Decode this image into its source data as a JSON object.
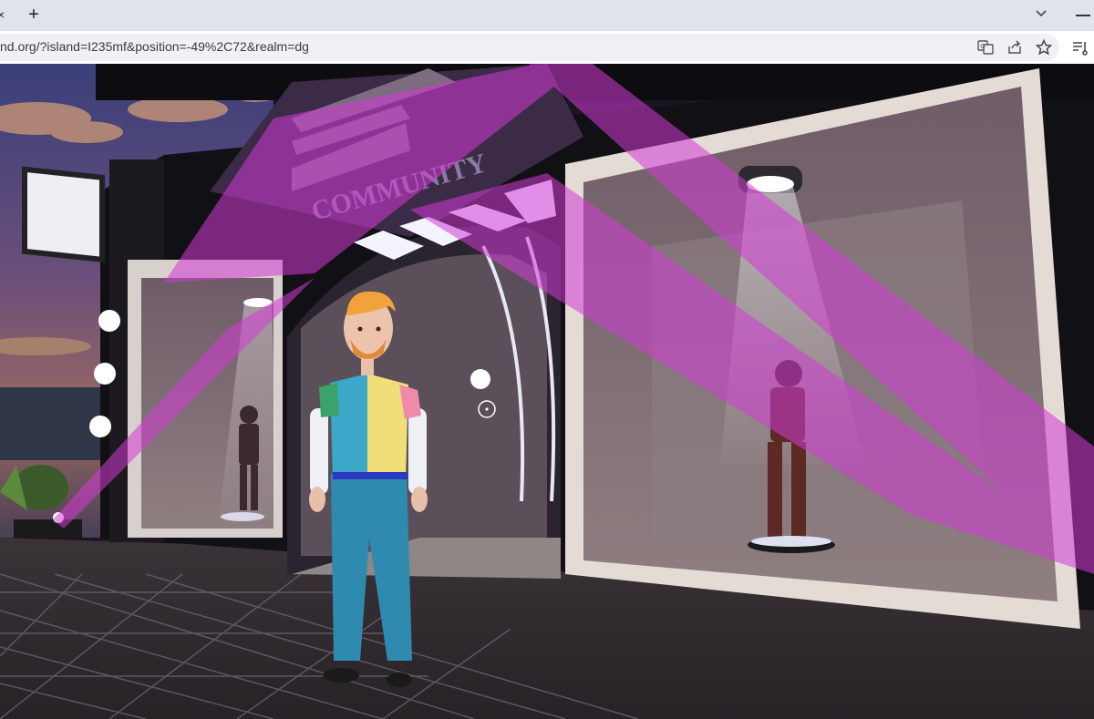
{
  "browser": {
    "tab_close_glyph": "×",
    "new_tab_glyph": "+",
    "url": "nd.org/?island=I235mf&position=-49%2C72&realm=dg",
    "icons": [
      "translate-icon",
      "share-icon",
      "bookmark-star-icon",
      "reading-list-icon",
      "tab-search-icon",
      "minimize-icon"
    ]
  },
  "scene": {
    "storefront_sign": "COMMUNITY"
  }
}
